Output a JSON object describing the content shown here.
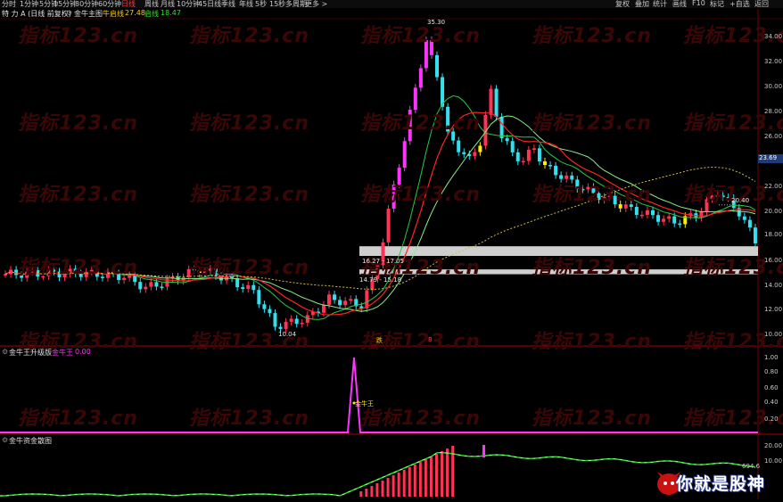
{
  "toolbar": {
    "left_items": [
      "分时",
      "1分钟",
      "5分钟",
      "15分钟",
      "30分钟",
      "60分钟",
      "日线",
      "周线",
      "月线",
      "10分钟",
      "45日线",
      "季线",
      "年线",
      "5秒",
      "15秒",
      "多周期",
      "更多 >"
    ],
    "active_index": 6,
    "right_items": [
      "复权",
      "叠加",
      "统计",
      "画线",
      "F10",
      "标记",
      "+自选",
      "返回"
    ]
  },
  "panel1": {
    "title": "特 力 A (日线 前复权)",
    "indicator": "金牛主图",
    "legend": [
      {
        "label": "牛启线",
        "value": "",
        "color": "#ffd200"
      },
      {
        "label": "",
        "value": "27.48",
        "color": "#ffd200"
      },
      {
        "label": "启线",
        "value": "",
        "color": "#33dd33"
      },
      {
        "label": "",
        "value": "18.47",
        "color": "#33dd33"
      }
    ],
    "price_ticks": [
      "34.00",
      "32.00",
      "30.00",
      "28.00",
      "26.00",
      "24.00",
      "22.00",
      "20.00",
      "18.00",
      "16.00",
      "14.00",
      "12.00",
      "10.00"
    ],
    "current_price_tag": "23.69",
    "annotations": {
      "high": "35.30",
      "low": "10.04",
      "zone_upper": "16.27 - 17.05",
      "zone_lower": "14.79 - 15.18",
      "right_label": "20.40",
      "marker_1": "跌",
      "marker_2": "B"
    }
  },
  "panel2": {
    "title": "金牛王升级版",
    "indicator": "金牛王",
    "value": "0.00",
    "ticks": [
      "1.00",
      "0.80",
      "0.60",
      "0.40",
      "0.20"
    ],
    "spike_label": "金牛王"
  },
  "panel3": {
    "title": "金牛资金散图",
    "ticks": [
      "20.00",
      "10.00"
    ],
    "right_value": "694.6"
  },
  "watermark_text": "指标123.cn",
  "logo_text": "你就是股神",
  "colors": {
    "up": "#ff3355",
    "down": "#33e0f0",
    "ma_green": "#22cc44",
    "ma_red": "#ff2222",
    "yellow": "#ffee00",
    "magenta": "#ff33ff",
    "zone": "#cfcfcf",
    "separator": "#b00000"
  }
}
